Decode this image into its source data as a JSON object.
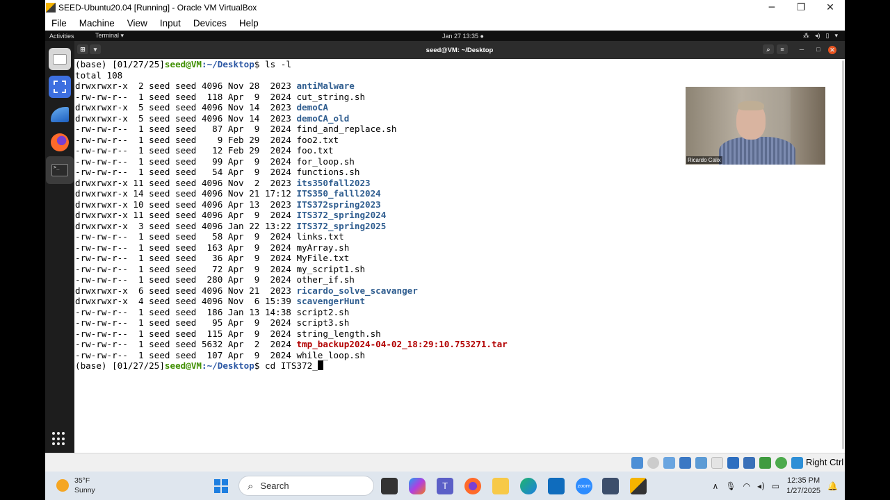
{
  "window": {
    "title": "SEED-Ubuntu20.04 [Running] - Oracle VM VirtualBox"
  },
  "menubar": [
    "File",
    "Machine",
    "View",
    "Input",
    "Devices",
    "Help"
  ],
  "gnome_topbar": {
    "activities": "Activities",
    "app_menu": "Terminal ▾",
    "clock": "Jan 27  13:35  ●"
  },
  "terminal": {
    "title": "seed@VM: ~/Desktop",
    "prompt_prefix": "(base) [01/27/25]",
    "prompt_user": "seed@VM",
    "prompt_path": ":~/Desktop",
    "prompt_symbol": "$ ",
    "command1": "ls -l",
    "total": "total 108",
    "entries": [
      {
        "meta": "drwxrwxr-x  2 seed seed 4096 Nov 28  2023 ",
        "name": "antiMalware",
        "kind": "dir"
      },
      {
        "meta": "-rw-rw-r--  1 seed seed  118 Apr  9  2024 ",
        "name": "cut_string.sh",
        "kind": "file"
      },
      {
        "meta": "drwxrwxr-x  5 seed seed 4096 Nov 14  2023 ",
        "name": "demoCA",
        "kind": "dir"
      },
      {
        "meta": "drwxrwxr-x  5 seed seed 4096 Nov 14  2023 ",
        "name": "demoCA_old",
        "kind": "dir"
      },
      {
        "meta": "-rw-rw-r--  1 seed seed   87 Apr  9  2024 ",
        "name": "find_and_replace.sh",
        "kind": "file"
      },
      {
        "meta": "-rw-rw-r--  1 seed seed    9 Feb 29  2024 ",
        "name": "foo2.txt",
        "kind": "file"
      },
      {
        "meta": "-rw-rw-r--  1 seed seed   12 Feb 29  2024 ",
        "name": "foo.txt",
        "kind": "file"
      },
      {
        "meta": "-rw-rw-r--  1 seed seed   99 Apr  9  2024 ",
        "name": "for_loop.sh",
        "kind": "file"
      },
      {
        "meta": "-rw-rw-r--  1 seed seed   54 Apr  9  2024 ",
        "name": "functions.sh",
        "kind": "file"
      },
      {
        "meta": "drwxrwxr-x 11 seed seed 4096 Nov  2  2023 ",
        "name": "its350fall2023",
        "kind": "dir"
      },
      {
        "meta": "drwxrwxr-x 14 seed seed 4096 Nov 21 17:12 ",
        "name": "ITS350_falll2024",
        "kind": "dir"
      },
      {
        "meta": "drwxrwxr-x 10 seed seed 4096 Apr 13  2023 ",
        "name": "ITS372spring2023",
        "kind": "dir"
      },
      {
        "meta": "drwxrwxr-x 11 seed seed 4096 Apr  9  2024 ",
        "name": "ITS372_spring2024",
        "kind": "dir"
      },
      {
        "meta": "drwxrwxr-x  3 seed seed 4096 Jan 22 13:22 ",
        "name": "ITS372_spring2025",
        "kind": "dir"
      },
      {
        "meta": "-rw-rw-r--  1 seed seed   58 Apr  9  2024 ",
        "name": "links.txt",
        "kind": "file"
      },
      {
        "meta": "-rw-rw-r--  1 seed seed  163 Apr  9  2024 ",
        "name": "myArray.sh",
        "kind": "file"
      },
      {
        "meta": "-rw-rw-r--  1 seed seed   36 Apr  9  2024 ",
        "name": "MyFile.txt",
        "kind": "file"
      },
      {
        "meta": "-rw-rw-r--  1 seed seed   72 Apr  9  2024 ",
        "name": "my_script1.sh",
        "kind": "file"
      },
      {
        "meta": "-rw-rw-r--  1 seed seed  280 Apr  9  2024 ",
        "name": "other_if.sh",
        "kind": "file"
      },
      {
        "meta": "drwxrwxr-x  6 seed seed 4096 Nov 21  2023 ",
        "name": "ricardo_solve_scavanger",
        "kind": "dir"
      },
      {
        "meta": "drwxrwxr-x  4 seed seed 4096 Nov  6 15:39 ",
        "name": "scavengerHunt",
        "kind": "dir"
      },
      {
        "meta": "-rw-rw-r--  1 seed seed  186 Jan 13 14:38 ",
        "name": "script2.sh",
        "kind": "file"
      },
      {
        "meta": "-rw-rw-r--  1 seed seed   95 Apr  9  2024 ",
        "name": "script3.sh",
        "kind": "file"
      },
      {
        "meta": "-rw-rw-r--  1 seed seed  115 Apr  9  2024 ",
        "name": "string_length.sh",
        "kind": "file"
      },
      {
        "meta": "-rw-rw-r--  1 seed seed 5632 Apr  2  2024 ",
        "name": "tmp_backup2024-04-02_18:29:10.753271.tar",
        "kind": "archive"
      },
      {
        "meta": "-rw-rw-r--  1 seed seed  107 Apr  9  2024 ",
        "name": "while_loop.sh",
        "kind": "file"
      }
    ],
    "command2": "cd ITS372_"
  },
  "webcam": {
    "name_label": "Ricardo Calix"
  },
  "statusbar": {
    "host_key": "Right Ctrl"
  },
  "taskbar": {
    "weather_temp": "35°F",
    "weather_desc": "Sunny",
    "search_placeholder": "Search",
    "time": "12:35 PM",
    "date": "1/27/2025"
  },
  "colors": {
    "prompt_user": "#3f8f00",
    "prompt_path": "#2a56a3",
    "directory": "#2f5d8f",
    "archive": "#b20000"
  }
}
